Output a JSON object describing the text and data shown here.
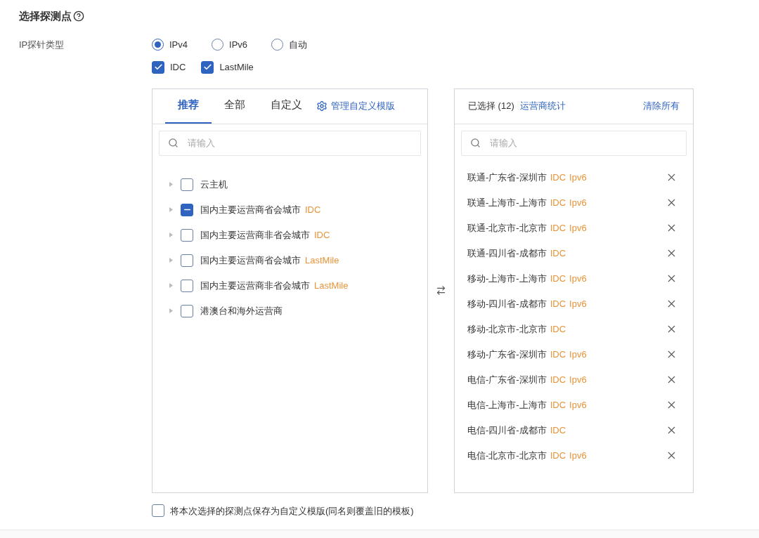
{
  "section": {
    "title": "选择探测点"
  },
  "ip_type": {
    "label": "IP探针类型",
    "radios": [
      {
        "label": "IPv4",
        "selected": true
      },
      {
        "label": "IPv6",
        "selected": false
      },
      {
        "label": "自动",
        "selected": false
      }
    ],
    "checkboxes": [
      {
        "label": "IDC",
        "checked": true
      },
      {
        "label": "LastMile",
        "checked": true
      }
    ]
  },
  "source_panel": {
    "tabs": [
      {
        "label": "推荐",
        "selected": true
      },
      {
        "label": "全部",
        "selected": false
      },
      {
        "label": "自定义",
        "selected": false
      }
    ],
    "manage_link": "管理自定义模版",
    "search": {
      "placeholder": "请输入"
    },
    "tree": [
      {
        "label": "云主机",
        "checked": false,
        "indeterminate": false
      },
      {
        "label": "国内主要运营商省会城市",
        "tag": "IDC",
        "checked": false,
        "indeterminate": true
      },
      {
        "label": "国内主要运营商非省会城市",
        "tag": "IDC",
        "checked": false,
        "indeterminate": false
      },
      {
        "label": "国内主要运营商省会城市",
        "tag": "LastMile",
        "checked": false,
        "indeterminate": false
      },
      {
        "label": "国内主要运营商非省会城市",
        "tag": "LastMile",
        "checked": false,
        "indeterminate": false
      },
      {
        "label": "港澳台和海外运营商",
        "checked": false,
        "indeterminate": false
      }
    ]
  },
  "target_panel": {
    "selected_count": "已选择 (12)",
    "stats_link": "运营商统计",
    "clear_all": "清除所有",
    "search": {
      "placeholder": "请输入"
    },
    "items": [
      {
        "name": "联通-广东省-深圳市",
        "tags": [
          "IDC",
          "Ipv6"
        ]
      },
      {
        "name": "联通-上海市-上海市",
        "tags": [
          "IDC",
          "Ipv6"
        ]
      },
      {
        "name": "联通-北京市-北京市",
        "tags": [
          "IDC",
          "Ipv6"
        ]
      },
      {
        "name": "联通-四川省-成都市",
        "tags": [
          "IDC"
        ]
      },
      {
        "name": "移动-上海市-上海市",
        "tags": [
          "IDC",
          "Ipv6"
        ]
      },
      {
        "name": "移动-四川省-成都市",
        "tags": [
          "IDC",
          "Ipv6"
        ]
      },
      {
        "name": "移动-北京市-北京市",
        "tags": [
          "IDC"
        ]
      },
      {
        "name": "移动-广东省-深圳市",
        "tags": [
          "IDC",
          "Ipv6"
        ]
      },
      {
        "name": "电信-广东省-深圳市",
        "tags": [
          "IDC",
          "Ipv6"
        ]
      },
      {
        "name": "电信-上海市-上海市",
        "tags": [
          "IDC",
          "Ipv6"
        ]
      },
      {
        "name": "电信-四川省-成都市",
        "tags": [
          "IDC"
        ]
      },
      {
        "name": "电信-北京市-北京市",
        "tags": [
          "IDC",
          "Ipv6"
        ]
      }
    ]
  },
  "save_template": {
    "label": "将本次选择的探测点保存为自定义模版(同名则覆盖旧的模板)",
    "checked": false
  }
}
